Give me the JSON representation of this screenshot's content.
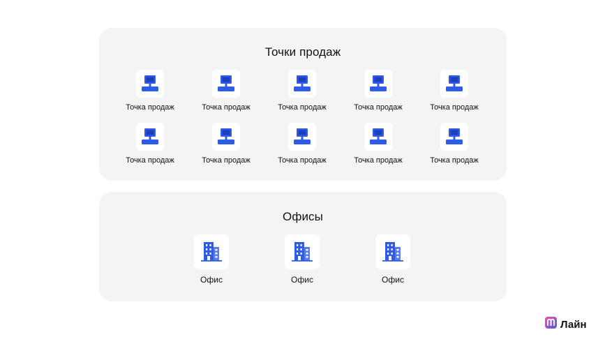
{
  "pos_section": {
    "title": "Точки продаж",
    "items": [
      {
        "label": "Точка продаж",
        "icon": "pos-terminal-icon"
      },
      {
        "label": "Точка продаж",
        "icon": "pos-terminal-icon"
      },
      {
        "label": "Точка продаж",
        "icon": "pos-terminal-icon"
      },
      {
        "label": "Точка продаж",
        "icon": "pos-terminal-icon"
      },
      {
        "label": "Точка продаж",
        "icon": "pos-terminal-icon"
      },
      {
        "label": "Точка продаж",
        "icon": "pos-terminal-icon"
      },
      {
        "label": "Точка продаж",
        "icon": "pos-terminal-icon"
      },
      {
        "label": "Точка продаж",
        "icon": "pos-terminal-icon"
      },
      {
        "label": "Точка продаж",
        "icon": "pos-terminal-icon"
      },
      {
        "label": "Точка продаж",
        "icon": "pos-terminal-icon"
      }
    ]
  },
  "office_section": {
    "title": "Офисы",
    "items": [
      {
        "label": "Офис",
        "icon": "office-building-icon"
      },
      {
        "label": "Офис",
        "icon": "office-building-icon"
      },
      {
        "label": "Офис",
        "icon": "office-building-icon"
      }
    ]
  },
  "brand": {
    "name": "Лайн",
    "icon": "brand-logo-icon"
  },
  "colors": {
    "accent": "#2f5bea",
    "panel": "#f4f4f4",
    "tile": "#ffffff"
  }
}
